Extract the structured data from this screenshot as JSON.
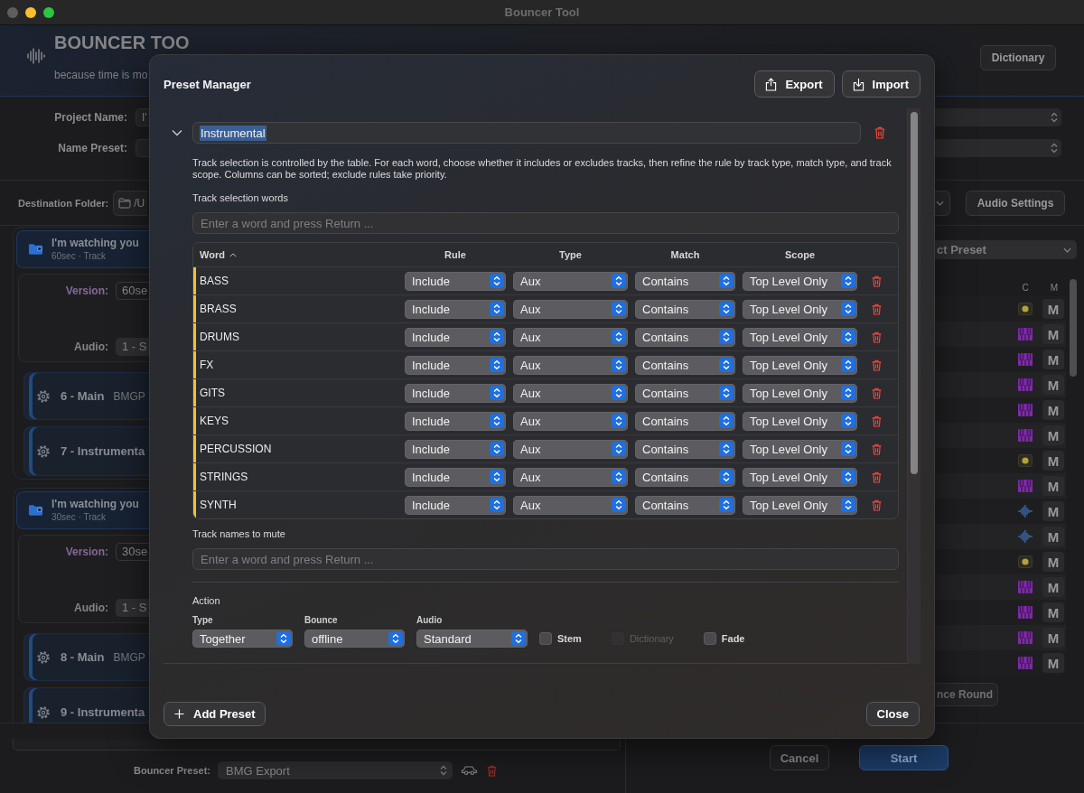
{
  "window": {
    "title": "Bouncer Tool"
  },
  "header": {
    "title": "BOUNCER TOO",
    "subtitle": "because time is mo",
    "dictionary_button": "Dictionary"
  },
  "project": {
    "fields": [
      {
        "label": "Project Name:",
        "value": "I'"
      },
      {
        "label": "Name Preset:"
      }
    ]
  },
  "destination": {
    "label": "Destination Folder:",
    "value": "/U",
    "audio_settings_button": "Audio Settings"
  },
  "groups": [
    {
      "title": "I'm watching you",
      "subtitle": "60sec · Track",
      "version_label": "Version:",
      "version": "60se",
      "audio_label": "Audio:",
      "audio": "1 - S",
      "items": [
        {
          "name": "6 - Main",
          "detail": "BMGP"
        },
        {
          "name": "7 - Instrumenta"
        }
      ]
    },
    {
      "title": "I'm watching you",
      "subtitle": "30sec · Track",
      "version_label": "Version:",
      "version": "30se",
      "audio_label": "Audio:",
      "audio": "1 - S",
      "items": [
        {
          "name": "8 - Main",
          "detail": "BMGP"
        },
        {
          "name": "9 - Instrumenta"
        }
      ]
    }
  ],
  "track_panel": {
    "preset_popup": "ct Preset",
    "columns": [
      "C",
      "M"
    ],
    "rows": [
      {
        "kind": "dot",
        "mute": "M"
      },
      {
        "kind": "keys",
        "mute": "M"
      },
      {
        "kind": "keys",
        "mute": "M"
      },
      {
        "kind": "keys",
        "mute": "M"
      },
      {
        "kind": "keys",
        "mute": "M"
      },
      {
        "kind": "keys",
        "mute": "M"
      },
      {
        "kind": "dot",
        "mute": "M"
      },
      {
        "kind": "keys",
        "mute": "M"
      },
      {
        "kind": "wave",
        "mute": "M"
      },
      {
        "kind": "wave",
        "mute": "M"
      },
      {
        "kind": "dot",
        "mute": "M"
      },
      {
        "kind": "keys",
        "mute": "M"
      },
      {
        "kind": "keys",
        "mute": "M"
      },
      {
        "kind": "keys",
        "mute": "M"
      },
      {
        "kind": "keys",
        "mute": "M"
      }
    ],
    "round_button": "nce Round"
  },
  "bottom_bar": {
    "preset_label": "Bouncer Preset:",
    "preset_value": "BMG Export",
    "cancel_button": "Cancel",
    "start_button": "Start"
  },
  "preset_manager": {
    "title": "Preset Manager",
    "buttons": [
      {
        "label": "Export",
        "kind": "export"
      },
      {
        "label": "Import",
        "kind": "import"
      }
    ],
    "preset": {
      "expanded": true,
      "name": "Instrumental",
      "name_selected": true,
      "description": "Track selection is controlled by the table. For each word, choose whether it includes or excludes tracks, then refine the rule by track type, match type, and track scope. Columns can be sorted; exclude rules take priority.",
      "words_label": "Track selection words",
      "words_placeholder": "Enter a word and press Return ...",
      "table": {
        "sort_ascending": true,
        "columns": [
          {
            "label": "Word",
            "sorted": true
          },
          {
            "label": "Rule",
            "sorted": false
          },
          {
            "label": "Type",
            "sorted": false
          },
          {
            "label": "Match",
            "sorted": false
          },
          {
            "label": "Scope",
            "sorted": false
          }
        ],
        "rows": [
          {
            "word": "BASS",
            "rule": "Include",
            "type": "Aux",
            "match": "Contains",
            "scope": "Top Level Only"
          },
          {
            "word": "BRASS",
            "rule": "Include",
            "type": "Aux",
            "match": "Contains",
            "scope": "Top Level Only"
          },
          {
            "word": "DRUMS",
            "rule": "Include",
            "type": "Aux",
            "match": "Contains",
            "scope": "Top Level Only"
          },
          {
            "word": "FX",
            "rule": "Include",
            "type": "Aux",
            "match": "Contains",
            "scope": "Top Level Only"
          },
          {
            "word": "GITS",
            "rule": "Include",
            "type": "Aux",
            "match": "Contains",
            "scope": "Top Level Only"
          },
          {
            "word": "KEYS",
            "rule": "Include",
            "type": "Aux",
            "match": "Contains",
            "scope": "Top Level Only"
          },
          {
            "word": "PERCUSSION",
            "rule": "Include",
            "type": "Aux",
            "match": "Contains",
            "scope": "Top Level Only"
          },
          {
            "word": "STRINGS",
            "rule": "Include",
            "type": "Aux",
            "match": "Contains",
            "scope": "Top Level Only"
          },
          {
            "word": "SYNTH",
            "rule": "Include",
            "type": "Aux",
            "match": "Contains",
            "scope": "Top Level Only"
          }
        ]
      },
      "mute_label": "Track names to mute",
      "mute_placeholder": "Enter a word and press Return ...",
      "action": {
        "label": "Action",
        "popups": [
          {
            "label": "Type",
            "value": "Together"
          },
          {
            "label": "Bounce",
            "value": "offline"
          },
          {
            "label": "Audio",
            "value": "Standard"
          }
        ],
        "options": [
          {
            "label": "Stem",
            "checked": false,
            "disabled": false
          },
          {
            "label": "Dictionary",
            "checked": false,
            "disabled": true
          },
          {
            "label": "Fade",
            "checked": false,
            "disabled": false
          }
        ]
      }
    },
    "add_button": "Add Preset",
    "close_button": "Close"
  }
}
